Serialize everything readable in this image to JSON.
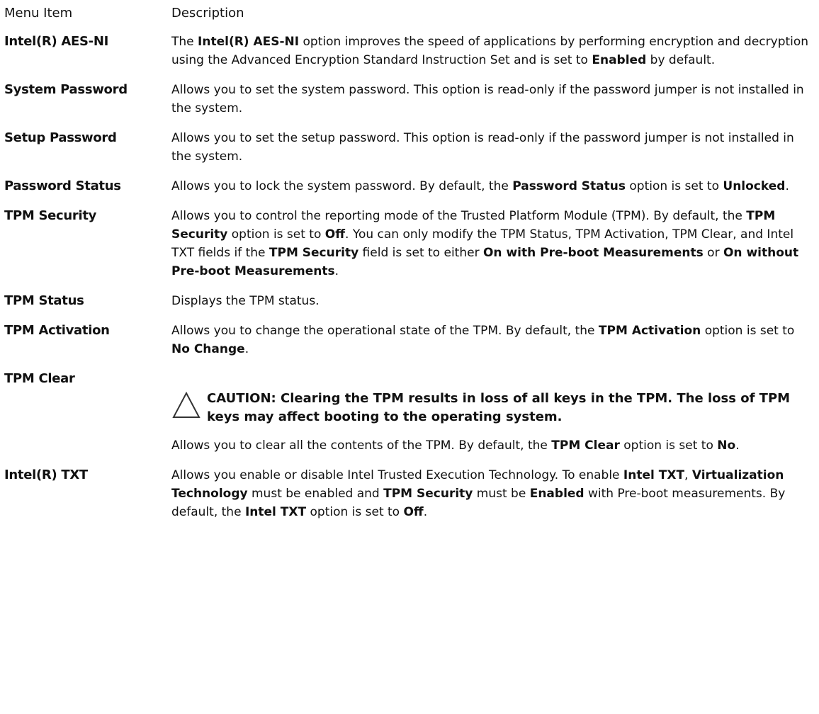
{
  "header": {
    "col_menu": "Menu Item",
    "col_desc": "Description"
  },
  "rows": [
    {
      "term": "Intel(R) AES-NI",
      "segments": [
        {
          "t": "The "
        },
        {
          "t": "Intel(R) AES-NI",
          "b": true
        },
        {
          "t": " option improves the speed of applications by performing encryption and decryption using the Advanced Encryption Standard Instruction Set and is set to "
        },
        {
          "t": "Enabled",
          "b": true
        },
        {
          "t": " by default."
        }
      ]
    },
    {
      "term": "System Password",
      "segments": [
        {
          "t": "Allows you to set the system password. This option is read-only if the password jumper is not installed in the system."
        }
      ]
    },
    {
      "term": "Setup Password",
      "segments": [
        {
          "t": "Allows you to set the setup password. This option is read-only if the password jumper is not installed in the system."
        }
      ]
    },
    {
      "term": "Password Status",
      "segments": [
        {
          "t": "Allows you to lock the system password. By default, the "
        },
        {
          "t": "Password Status",
          "b": true
        },
        {
          "t": " option is set to "
        },
        {
          "t": "Unlocked",
          "b": true
        },
        {
          "t": "."
        }
      ]
    },
    {
      "term": "TPM Security",
      "segments": [
        {
          "t": "Allows you to control the reporting mode of the Trusted Platform Module (TPM). By default, the "
        },
        {
          "t": "TPM Security",
          "b": true
        },
        {
          "t": " option is set to "
        },
        {
          "t": "Off",
          "b": true
        },
        {
          "t": ". You can only modify the TPM Status, TPM Activation, TPM Clear, and Intel TXT fields if the "
        },
        {
          "t": "TPM Security",
          "b": true
        },
        {
          "t": " field is set to either "
        },
        {
          "t": "On with Pre-boot Measurements",
          "b": true
        },
        {
          "t": " or "
        },
        {
          "t": "On without Pre-boot Measurements",
          "b": true
        },
        {
          "t": "."
        }
      ]
    },
    {
      "term": "TPM Status",
      "segments": [
        {
          "t": "Displays the TPM status."
        }
      ]
    },
    {
      "term": "TPM Activation",
      "segments": [
        {
          "t": "Allows you to change the operational state of the TPM. By default, the "
        },
        {
          "t": "TPM Activation",
          "b": true
        },
        {
          "t": " option is set to "
        },
        {
          "t": "No Change",
          "b": true
        },
        {
          "t": "."
        }
      ]
    },
    {
      "term": "TPM Clear",
      "caution": "CAUTION: Clearing the TPM results in loss of all keys in the TPM. The loss of TPM keys may affect booting to the operating system.",
      "caution_icon": "warning-triangle-icon",
      "segments": [
        {
          "t": "Allows you to clear all the contents of the TPM. By default, the "
        },
        {
          "t": "TPM Clear",
          "b": true
        },
        {
          "t": " option is set to "
        },
        {
          "t": "No",
          "b": true
        },
        {
          "t": "."
        }
      ]
    },
    {
      "term": "Intel(R) TXT",
      "segments": [
        {
          "t": "Allows you enable or disable Intel Trusted Execution Technology. To enable "
        },
        {
          "t": "Intel TXT",
          "b": true
        },
        {
          "t": ", "
        },
        {
          "t": "Virtualization Technology",
          "b": true
        },
        {
          "t": " must be enabled and "
        },
        {
          "t": "TPM Security",
          "b": true
        },
        {
          "t": " must be "
        },
        {
          "t": "Enabled",
          "b": true
        },
        {
          "t": " with Pre-boot measurements. By default, the "
        },
        {
          "t": "Intel TXT",
          "b": true
        },
        {
          "t": " option is set to "
        },
        {
          "t": "Off",
          "b": true
        },
        {
          "t": "."
        }
      ]
    }
  ]
}
